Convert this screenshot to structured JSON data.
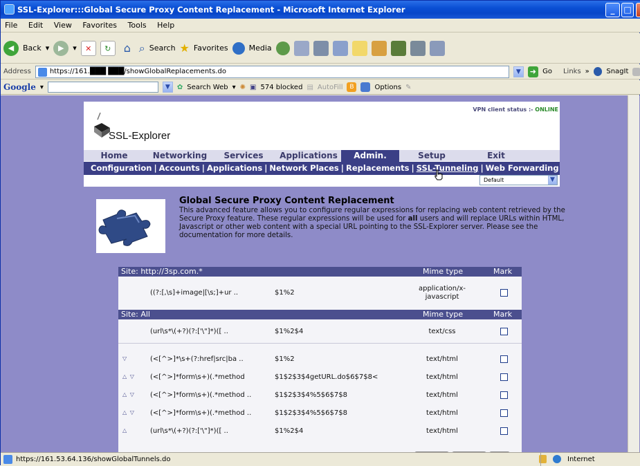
{
  "window": {
    "title": "SSL-Explorer:::Global Secure Proxy Content Replacement - Microsoft Internet Explorer"
  },
  "menu": [
    "File",
    "Edit",
    "View",
    "Favorites",
    "Tools",
    "Help"
  ],
  "toolbar": {
    "back": "Back",
    "search": "Search",
    "favorites": "Favorites",
    "media": "Media"
  },
  "address": {
    "label": "Address",
    "url": "https://161.███ ███/showGlobalReplacements.do",
    "go": "Go",
    "links": "Links",
    "snagit": "SnagIt"
  },
  "google_bar": {
    "logo": "Google",
    "search_web": "Search Web",
    "blocked": "574 blocked",
    "autofill": "AutoFill",
    "options": "Options"
  },
  "app": {
    "logo_text": "SSL-Explorer",
    "vpn_label": "VPN client status :-",
    "vpn_status": "ONLINE",
    "tabs": [
      "Home",
      "Networking",
      "Services",
      "Applications",
      "Admin.",
      "Setup",
      "Exit"
    ],
    "active_tab": "Admin.",
    "subnav": [
      "Configuration",
      "Accounts",
      "Applications",
      "Network Places",
      "Replacements",
      "SSL-Tunneling",
      "Web Forwarding"
    ],
    "profile_select": "Default",
    "intro": {
      "title": "Global Secure Proxy Content Replacement",
      "text_before": "This advanced feature allows you to configure regular expressions for replacing web content retrieved by the Secure Proxy feature. These regular expressions will be used for ",
      "text_bold": "all",
      "text_after": " users and will replace URLs within HTML, Javascript or other web content with a special URL pointing to the SSL-Explorer server. Please see the documentation for more details."
    },
    "table": {
      "mime_header": "Mime type",
      "mark_header": "Mark",
      "groups": [
        {
          "site": "Site: http://3sp.com.*",
          "rows": [
            {
              "pattern": "((?:[,\\s]+image|[\\s;]+ur ..",
              "replacement": "$1%2",
              "mime_line1": "application/x-",
              "mime_line2": "javascript"
            }
          ]
        },
        {
          "site": "Site: All",
          "rows": [
            {
              "pattern": "(url\\s*\\(+?)(?:['\\\"]*)([ ..",
              "replacement": "$1%2$4",
              "mime": "text/css"
            },
            {
              "pattern": "(<[^>]*\\s+(?:href|src|ba ..",
              "replacement": "$1%2",
              "mime": "text/html",
              "arrows": "▽"
            },
            {
              "pattern": "(<[^>]*form\\s+)(.*method",
              "replacement": "$1$2$3$4getURL.do$6$7$8<",
              "mime": "text/html",
              "arrows": "△ ▽"
            },
            {
              "pattern": "(<[^>]*form\\s+)(.*method ..",
              "replacement": "$1$2$3$4%5$6$7$8",
              "mime": "text/html",
              "arrows": "△ ▽"
            },
            {
              "pattern": "(<[^>]*form\\s+)(.*method ..",
              "replacement": "$1$2$3$4%5$6$7$8",
              "mime": "text/html",
              "arrows": "△ ▽"
            },
            {
              "pattern": "(url\\s*\\(+?)(?:['\\\"]*)([ ..",
              "replacement": "$1%2$4",
              "mime": "text/html",
              "arrows": "△"
            }
          ]
        }
      ]
    }
  },
  "status": {
    "url": "https://161.53.64.136/showGlobalTunnels.do",
    "zone": "Internet"
  }
}
